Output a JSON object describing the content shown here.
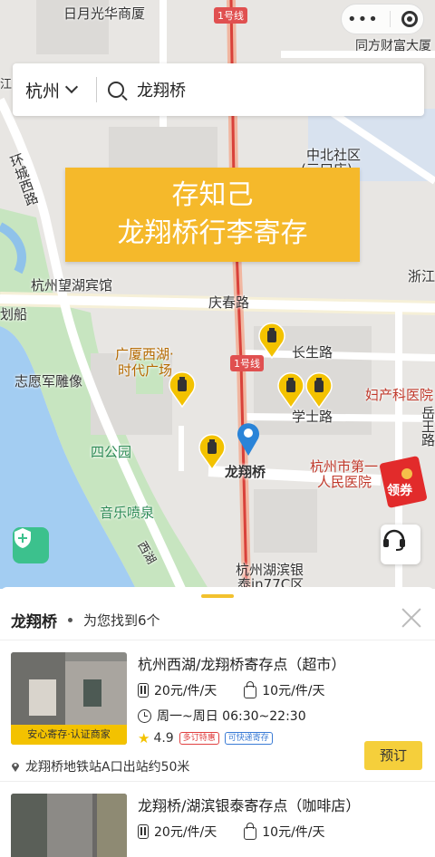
{
  "map": {
    "labels": {
      "riyue": "日月光华商厦",
      "line1_top": "1号线",
      "tongfang": "同方财富大厦",
      "zhongbei": "中北社区",
      "sankou": "(三口店)",
      "huancheng": "环城西路",
      "wanghu": "杭州望湖宾馆",
      "zhe": "浙江",
      "qingchun": "庆春路",
      "huashan": "划船",
      "guangsha": "广厦西湖·",
      "shidai": "时代广场",
      "changsheng": "长生路",
      "line1_mid": "1号线",
      "zhiyuanjun": "志愿军雕像",
      "fuchan": "妇产科医院",
      "xueshi": "学士路",
      "yue": "岳王路",
      "sigongyuan": "四公园",
      "longxiang": "龙翔桥",
      "hangzhoudiyi": "杭州市第一",
      "renmin": "人民医院",
      "yinyue": "音乐喷泉",
      "xihu": "西湖",
      "binhu": "杭州湖滨银",
      "yintai": "泰in77C区",
      "jiang": "江"
    }
  },
  "search": {
    "city": "杭州",
    "query": "龙翔桥"
  },
  "banner": {
    "line1": "存知己",
    "line2": "龙翔桥行李寄存"
  },
  "coupon": {
    "label": "领券"
  },
  "panel": {
    "title": "龙翔桥",
    "count_text": "为您找到6个"
  },
  "results": [
    {
      "name": "杭州西湖/龙翔桥寄存点（超市）",
      "badge": "安心寄存·认证商家",
      "price_large": "20元/件/天",
      "price_small": "10元/件/天",
      "hours": "周一~周日 06:30~22:30",
      "rating": "4.9",
      "tags": [
        "多订特惠",
        "可快递寄存"
      ],
      "address": "龙翔桥地铁站A口出站约50米",
      "book_label": "预订"
    },
    {
      "name": "龙翔桥/湖滨银泰寄存点（咖啡店）",
      "price_large": "20元/件/天",
      "price_small": "10元/件/天"
    }
  ],
  "colors": {
    "accent": "#f5b92b",
    "lake": "#a3cdf2",
    "park": "#c7e5c0",
    "metro": "#e05050",
    "book": "#f5cf3b"
  }
}
